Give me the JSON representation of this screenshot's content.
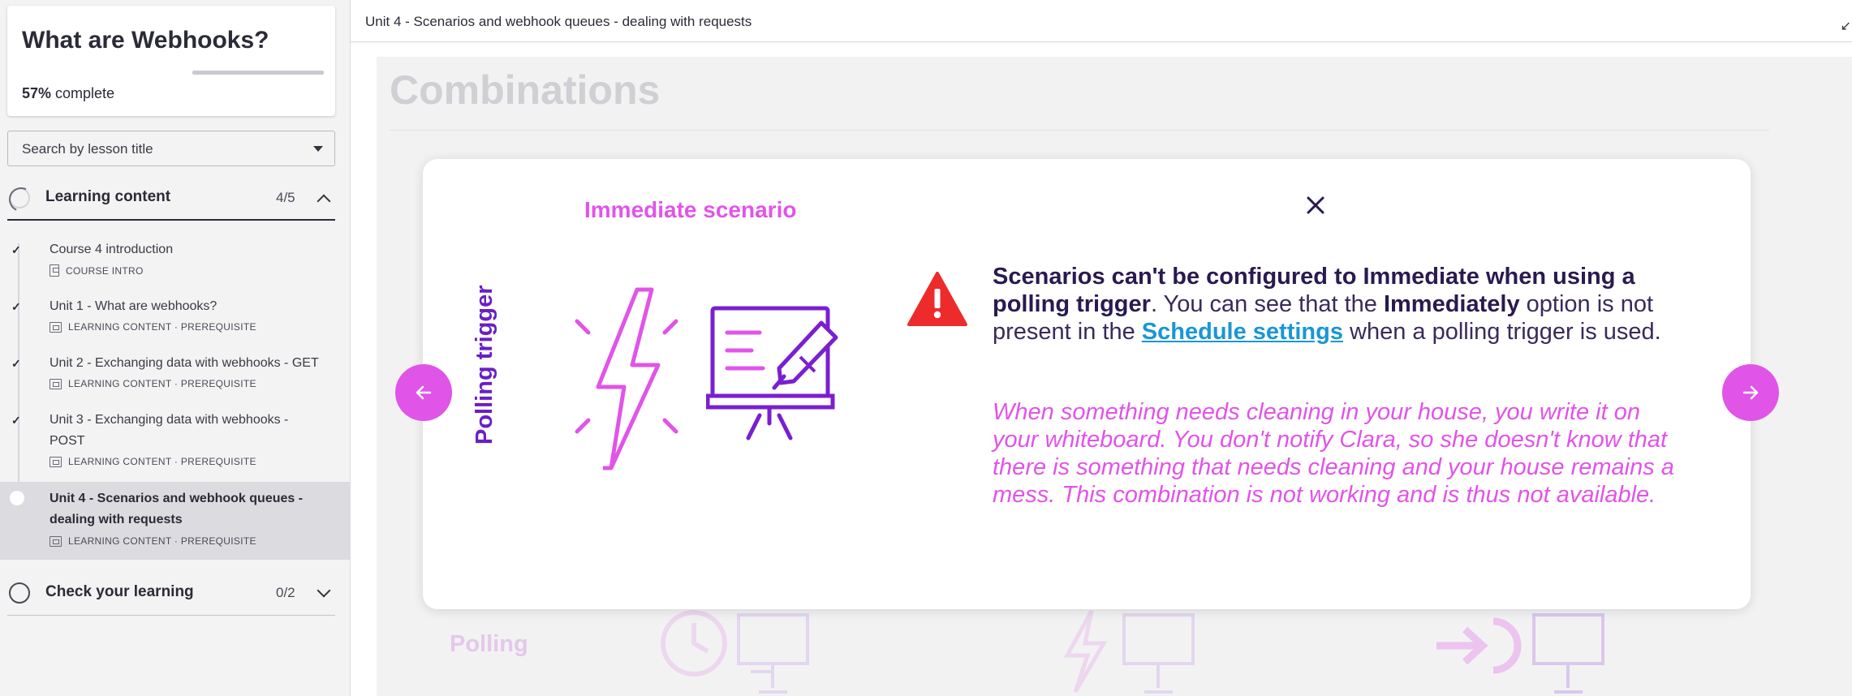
{
  "sidebar": {
    "course_title": "What are Webhooks?",
    "progress_percent": "57%",
    "progress_suffix": " complete",
    "progress_fraction": 0.57,
    "search_placeholder": "Search by lesson title",
    "sections": [
      {
        "title": "Learning content",
        "count": "4/5",
        "state": "expanded"
      },
      {
        "title": "Check your learning",
        "count": "0/2",
        "state": "collapsed"
      }
    ],
    "lessons": [
      {
        "title": "Course 4 introduction",
        "meta": "COURSE INTRO",
        "completed": true
      },
      {
        "title": "Unit 1 - What are webhooks?",
        "meta": "LEARNING CONTENT · PREREQUISITE",
        "completed": true
      },
      {
        "title": "Unit 2 - Exchanging data with webhooks - GET",
        "meta": "LEARNING CONTENT · PREREQUISITE",
        "completed": true
      },
      {
        "title": "Unit 3 - Exchanging data with webhooks - POST",
        "meta": "LEARNING CONTENT · PREREQUISITE",
        "completed": true
      },
      {
        "title": "Unit 4 - Scenarios and webhook queues - dealing with requests",
        "meta": "LEARNING CONTENT · PREREQUISITE",
        "completed": false,
        "active": true
      }
    ]
  },
  "topbar": {
    "title": "Unit 4 - Scenarios and webhook queues - dealing with requests"
  },
  "background": {
    "heading": "Combinations",
    "row_label": "Polling"
  },
  "modal": {
    "column_label": "Immediate scenario",
    "row_label": "Polling trigger",
    "message_bold_1": "Scenarios can't be configured to Immediate when using a polling trigger",
    "message_text_1": ". You can see that the ",
    "message_bold_2": "Immediately",
    "message_text_2": " option is not present in the ",
    "message_link": "Schedule settings",
    "message_text_3": " when a polling trigger is used.",
    "analogy": "When something needs cleaning in your house, you write it on your whiteboard. You don't notify Clara, so she doesn't know that there is something that needs cleaning and your house remains a mess. This combination is not working and is thus not available."
  },
  "icons": {
    "close": "close-icon",
    "prev": "arrow-left-icon",
    "next": "arrow-right-icon",
    "warning": "warning-triangle-icon",
    "lightning": "lightning-bolt-icon",
    "whiteboard": "whiteboard-marker-icon",
    "expand": "chevron-up-icon",
    "collapse": "chevron-down-icon",
    "minimize": "minimize-arrows-icon"
  },
  "colors": {
    "accent_pink": "#e154e8",
    "accent_purple": "#6a1fc4",
    "link_blue": "#1a96d6",
    "warning_red": "#ee2b2b"
  }
}
